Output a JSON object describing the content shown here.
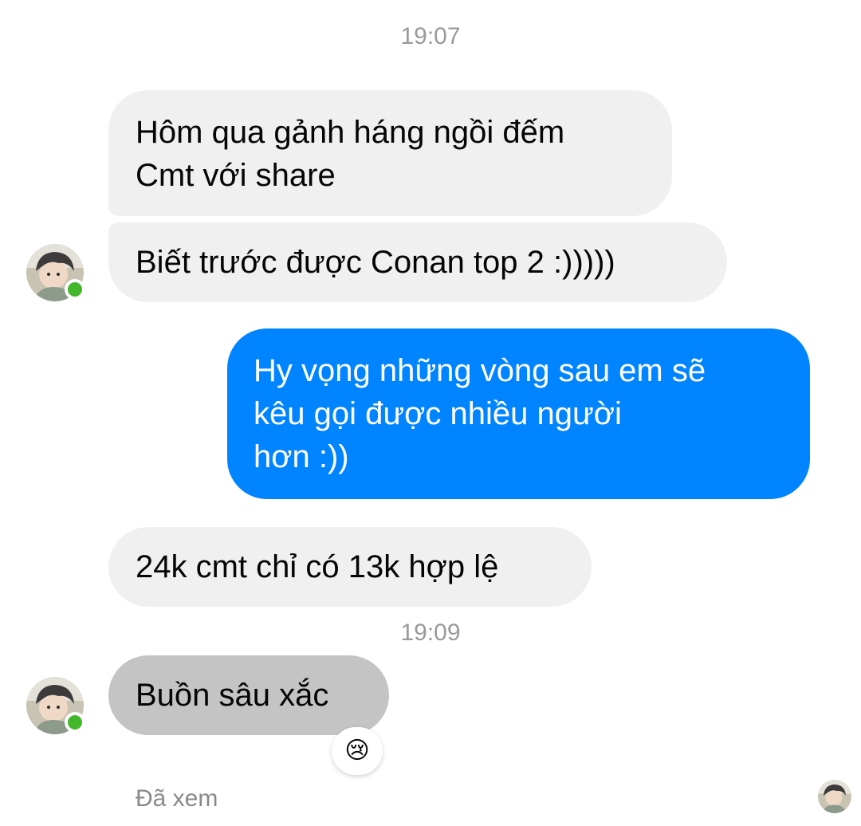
{
  "timestamps": [
    "19:07",
    "19:09"
  ],
  "messages": [
    {
      "lines": [
        "Hôm qua gảnh háng ngồi đếm",
        "Cmt với share"
      ]
    },
    {
      "lines": [
        "Biết trước được Conan top 2 :)))))"
      ]
    },
    {
      "lines": [
        "Hy vọng những vòng sau em sẽ",
        "kêu gọi được nhiều người",
        "hơn :))"
      ]
    },
    {
      "lines": [
        "24k cmt chỉ có 13k hợp lệ"
      ]
    },
    {
      "lines": [
        "Buồn sâu xắc"
      ]
    }
  ],
  "reaction_emoji": "😢",
  "seen_text": "Đã xem",
  "colors": {
    "incoming_bubble": "#f0f0f0",
    "outgoing_bubble": "#0084ff",
    "selected_bubble": "#c4c4c4",
    "online_dot": "#42b72a",
    "timestamp": "#9a9a9a"
  }
}
